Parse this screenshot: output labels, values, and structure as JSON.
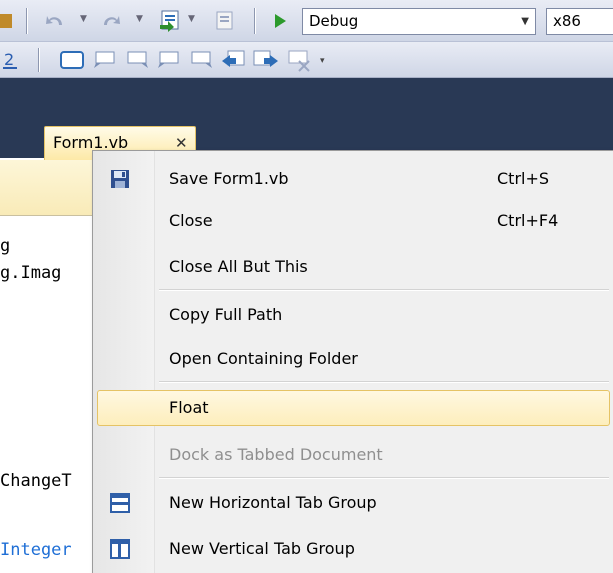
{
  "toolbar": {
    "config": "Debug",
    "platform": "x86"
  },
  "tab": {
    "title": "Form1.vb",
    "close": "✕"
  },
  "code": {
    "line1": "g",
    "line2": "g.Imag",
    "line3": "ChangeT",
    "line4": "Integer"
  },
  "menu": {
    "items": [
      {
        "label": "Save Form1.vb",
        "shortcut": "Ctrl+S",
        "icon": "save-icon"
      },
      {
        "label": "Close",
        "shortcut": "Ctrl+F4"
      },
      {
        "label": "Close All But This"
      },
      {
        "label": "Copy Full Path"
      },
      {
        "label": "Open Containing Folder"
      },
      {
        "label": "Float"
      },
      {
        "label": "Dock as Tabbed Document"
      },
      {
        "label": "New Horizontal Tab Group",
        "icon": "horizontal-tab-group-icon"
      },
      {
        "label": "New Vertical Tab Group",
        "icon": "vertical-tab-group-icon"
      }
    ]
  },
  "colors": {
    "tab_strip": "#293955",
    "highlight": "#fdeebc",
    "keyword": "#1f6fd6"
  }
}
